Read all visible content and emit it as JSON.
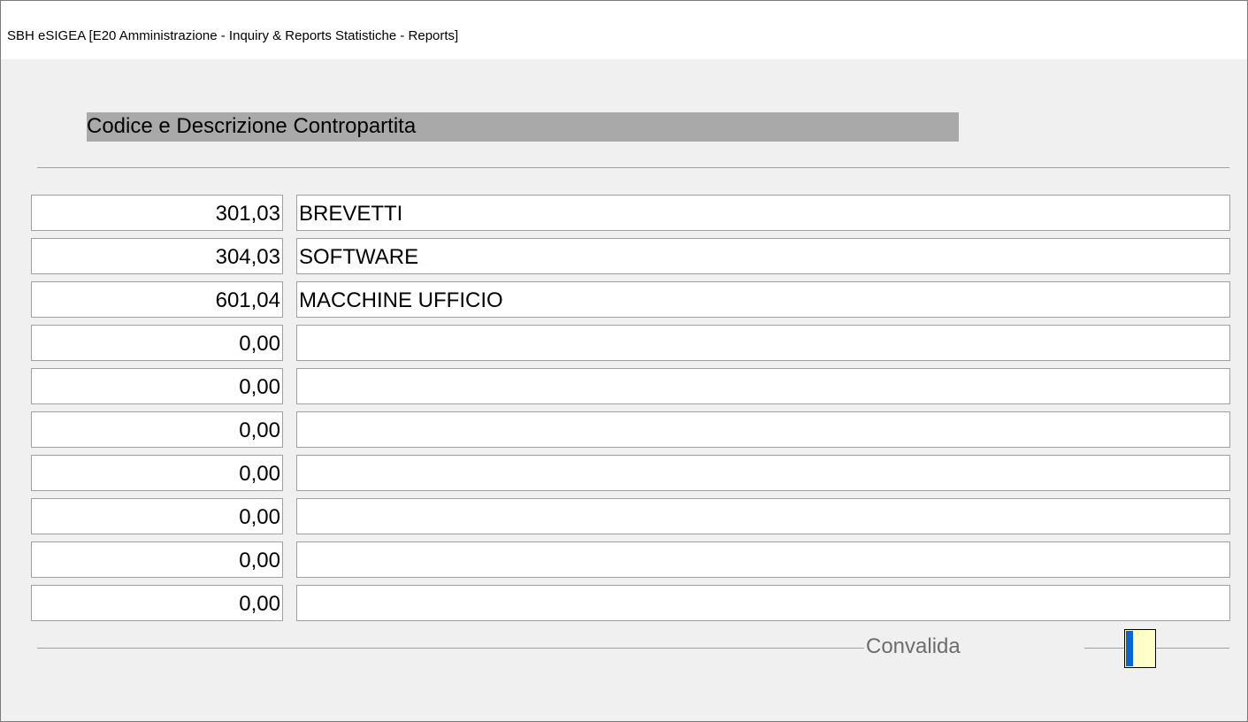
{
  "window": {
    "title": "SBH eSIGEA [E20 Amministrazione - Inquiry & Reports Statistiche - Reports]"
  },
  "section": {
    "header": "Codice  e  Descrizione Contropartita"
  },
  "rows": [
    {
      "code": "301,03",
      "description": "BREVETTI"
    },
    {
      "code": "304,03",
      "description": "SOFTWARE"
    },
    {
      "code": "601,04",
      "description": "MACCHINE UFFICIO"
    },
    {
      "code": "0,00",
      "description": ""
    },
    {
      "code": "0,00",
      "description": ""
    },
    {
      "code": "0,00",
      "description": ""
    },
    {
      "code": "0,00",
      "description": ""
    },
    {
      "code": "0,00",
      "description": ""
    },
    {
      "code": "0,00",
      "description": ""
    },
    {
      "code": "0,00",
      "description": ""
    }
  ],
  "footer": {
    "convalida_label": "Convalida"
  },
  "colors": {
    "background": "#f0f0f0",
    "header_bar": "#a9a9a9",
    "convalida_fill": "#ffffc8",
    "convalida_accent": "#0a64d2"
  }
}
